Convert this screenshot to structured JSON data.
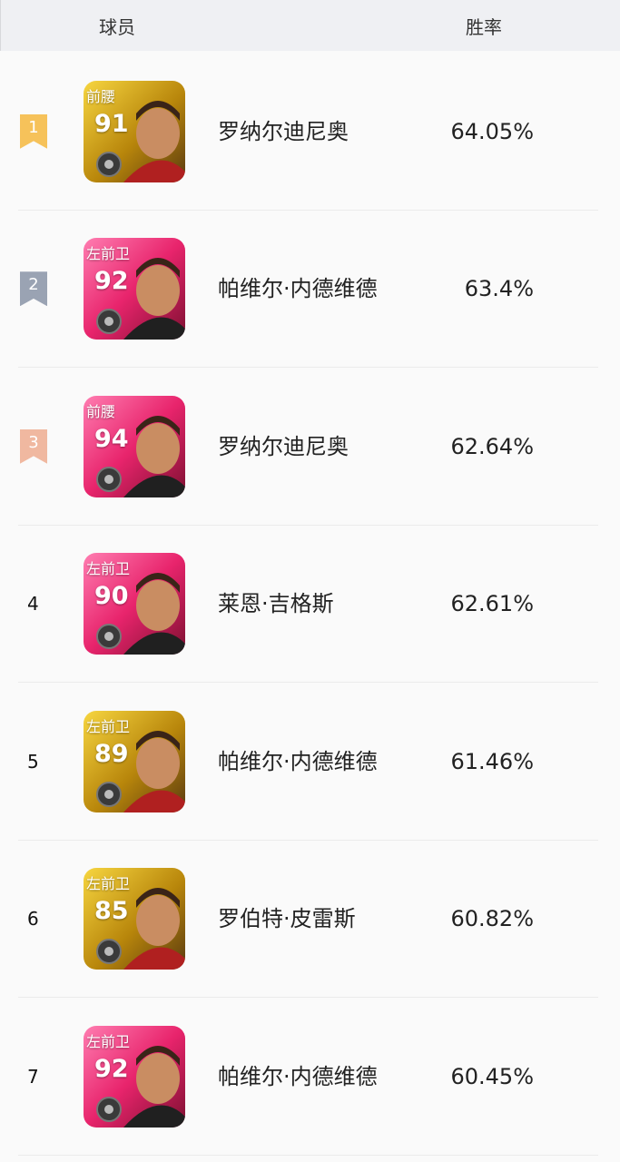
{
  "header": {
    "player_label": "球员",
    "winrate_label": "胜率"
  },
  "rows": [
    {
      "rank": "1",
      "medal": "gold",
      "position": "前腰",
      "rating": "91",
      "card": "gold",
      "name": "罗纳尔迪尼奥",
      "winrate": "64.05%"
    },
    {
      "rank": "2",
      "medal": "silver",
      "position": "左前卫",
      "rating": "92",
      "card": "pink",
      "name": "帕维尔·内德维德",
      "winrate": "63.4%"
    },
    {
      "rank": "3",
      "medal": "bronze",
      "position": "前腰",
      "rating": "94",
      "card": "pink",
      "name": "罗纳尔迪尼奥",
      "winrate": "62.64%"
    },
    {
      "rank": "4",
      "medal": "",
      "position": "左前卫",
      "rating": "90",
      "card": "pink",
      "name": "莱恩·吉格斯",
      "winrate": "62.61%"
    },
    {
      "rank": "5",
      "medal": "",
      "position": "左前卫",
      "rating": "89",
      "card": "gold",
      "name": "帕维尔·内德维德",
      "winrate": "61.46%"
    },
    {
      "rank": "6",
      "medal": "",
      "position": "左前卫",
      "rating": "85",
      "card": "gold",
      "name": "罗伯特·皮雷斯",
      "winrate": "60.82%"
    },
    {
      "rank": "7",
      "medal": "",
      "position": "左前卫",
      "rating": "92",
      "card": "pink",
      "name": "帕维尔·内德维德",
      "winrate": "60.45%"
    }
  ],
  "colors": {
    "gold": "#f6c25a",
    "silver": "#9aa3b3",
    "bronze": "#f0b8a0"
  }
}
